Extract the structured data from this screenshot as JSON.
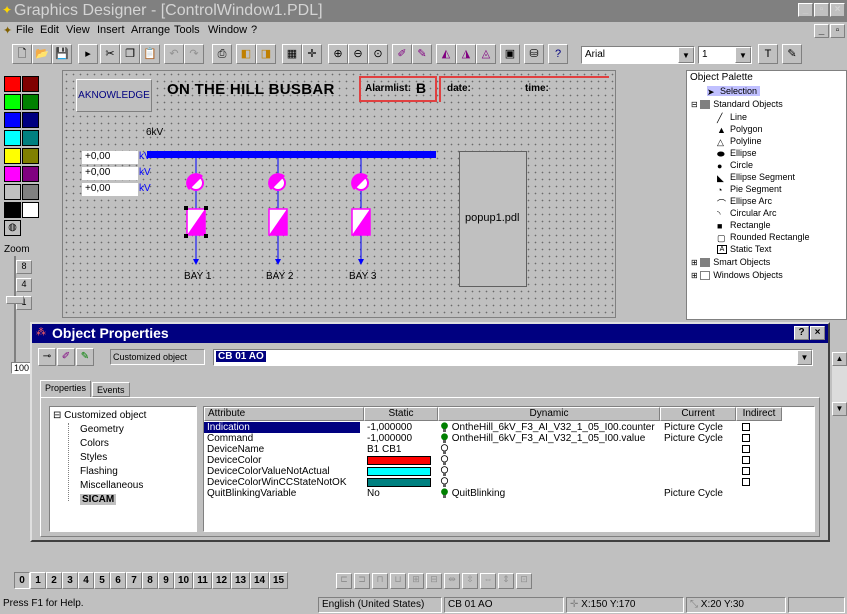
{
  "window": {
    "title": "Graphics Designer - [ControlWindow1.PDL]"
  },
  "menu": [
    "File",
    "Edit",
    "View",
    "Insert",
    "Arrange",
    "Tools",
    "Window",
    "?"
  ],
  "toolbar": {
    "font": "Arial",
    "size": "1"
  },
  "picture": {
    "ack_label": "AKNOWLEDGE",
    "title": "ON THE HILL BUSBAR",
    "alarm_label": "Alarmlist:",
    "alarm_value": "B",
    "date_label": "date:",
    "time_label": "time:",
    "voltage_label": "6kV",
    "readings": [
      {
        "value": "+0,00",
        "unit": "kV"
      },
      {
        "value": "+0,00",
        "unit": "kV"
      },
      {
        "value": "+0,00",
        "unit": "kV"
      }
    ],
    "bays": [
      "BAY 1",
      "BAY 2",
      "BAY 3"
    ],
    "popup": "popup1.pdl",
    "colors": {
      "busbar": "#0000ff",
      "breaker": "#ff00ff",
      "alarm_border": "#e04040"
    }
  },
  "palette": {
    "title": "Object Palette",
    "selection": "Selection",
    "standard": "Standard Objects",
    "items": [
      "Line",
      "Polygon",
      "Polyline",
      "Ellipse",
      "Circle",
      "Ellipse Segment",
      "Pie Segment",
      "Ellipse Arc",
      "Circular Arc",
      "Rectangle",
      "Rounded Rectangle",
      "Static Text"
    ],
    "smart": "Smart Objects",
    "windows": "Windows Objects"
  },
  "zoom": {
    "label": "Zoom",
    "marks": [
      "8",
      "4",
      "1"
    ],
    "value": "100"
  },
  "dialog": {
    "title": "Object Properties",
    "object_type": "Customized object",
    "object_name": "CB 01 AO",
    "tabs": [
      "Properties",
      "Events"
    ],
    "tree_root": "Customized object",
    "tree_items": [
      "Geometry",
      "Colors",
      "Styles",
      "Flashing",
      "Miscellaneous",
      "SICAM"
    ],
    "columns": [
      "Attribute",
      "Static",
      "Dynamic",
      "Current",
      "Indirect"
    ],
    "rows": [
      {
        "attr": "Indication",
        "static": "-1,000000",
        "dynamic": "OntheHill_6kV_F3_AI_V32_1_05_I00.counter",
        "current": "Picture Cycle",
        "bulb": "green"
      },
      {
        "attr": "Command",
        "static": "-1,000000",
        "dynamic": "OntheHill_6kV_F3_AI_V32_1_05_I00.value",
        "current": "Picture Cycle",
        "bulb": "green"
      },
      {
        "attr": "DeviceName",
        "static": "B1 CB1",
        "dynamic": "",
        "current": "",
        "bulb": "white"
      },
      {
        "attr": "DeviceColor",
        "static": "",
        "static_color": "#ff0000",
        "dynamic": "",
        "current": "",
        "bulb": "white"
      },
      {
        "attr": "DeviceColorValueNotActual",
        "static": "",
        "static_color": "#00ffff",
        "dynamic": "",
        "current": "",
        "bulb": "white"
      },
      {
        "attr": "DeviceColorWinCCStateNotOK",
        "static": "",
        "static_color": "#008080",
        "dynamic": "",
        "current": "",
        "bulb": "white"
      },
      {
        "attr": "QuitBlinkingVariable",
        "static": "No",
        "dynamic": "QuitBlinking",
        "current": "Picture Cycle",
        "bulb": "green"
      }
    ]
  },
  "layers": [
    "0",
    "1",
    "2",
    "3",
    "4",
    "5",
    "6",
    "7",
    "8",
    "9",
    "10",
    "11",
    "12",
    "13",
    "14",
    "15"
  ],
  "status": {
    "help": "Press F1 for Help.",
    "language": "English (United States)",
    "object": "CB 01 AO",
    "position": "X:150 Y:170",
    "size": "X:20 Y:30"
  }
}
